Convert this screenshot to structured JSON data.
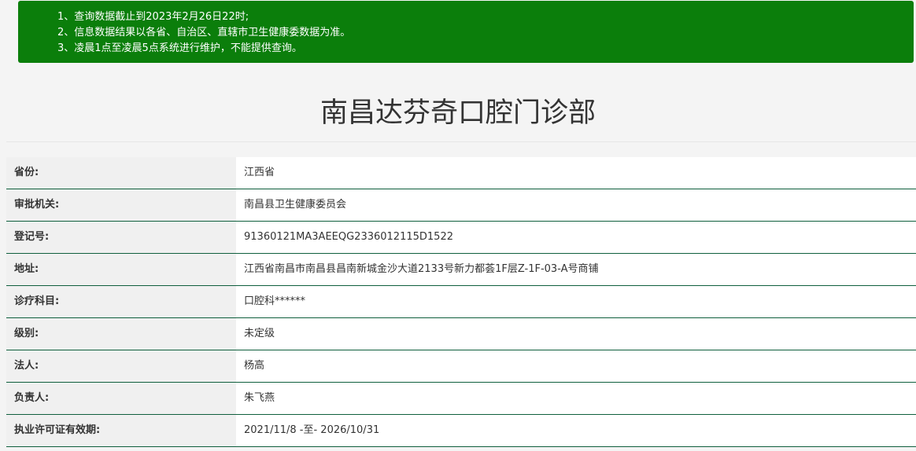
{
  "notice": {
    "lines": [
      "1、查询数据截止到2023年2月26日22时;",
      "2、信息数据结果以各省、自治区、直辖市卫生健康委数据为准。",
      "3、凌晨1点至凌晨5点系统进行维护，不能提供查询。"
    ],
    "background_color": "#0b7e0b"
  },
  "title": "南昌达芬奇口腔门诊部",
  "info": {
    "rows": [
      {
        "label": "省份:",
        "value": "江西省"
      },
      {
        "label": "审批机关:",
        "value": "南昌县卫生健康委员会"
      },
      {
        "label": "登记号:",
        "value": "91360121MA3AEEQG2336012115D1522"
      },
      {
        "label": "地址:",
        "value": "江西省南昌市南昌县昌南新城金沙大道2133号新力都荟1F层Z-1F-03-A号商铺"
      },
      {
        "label": "诊疗科目:",
        "value": "口腔科******"
      },
      {
        "label": "级别:",
        "value": "未定级"
      },
      {
        "label": "法人:",
        "value": "杨高"
      },
      {
        "label": "负责人:",
        "value": "朱飞燕"
      },
      {
        "label": "执业许可证有效期:",
        "value": "2021/11/8 -至- 2026/10/31"
      }
    ],
    "divider_color": "#0f5f3d"
  }
}
